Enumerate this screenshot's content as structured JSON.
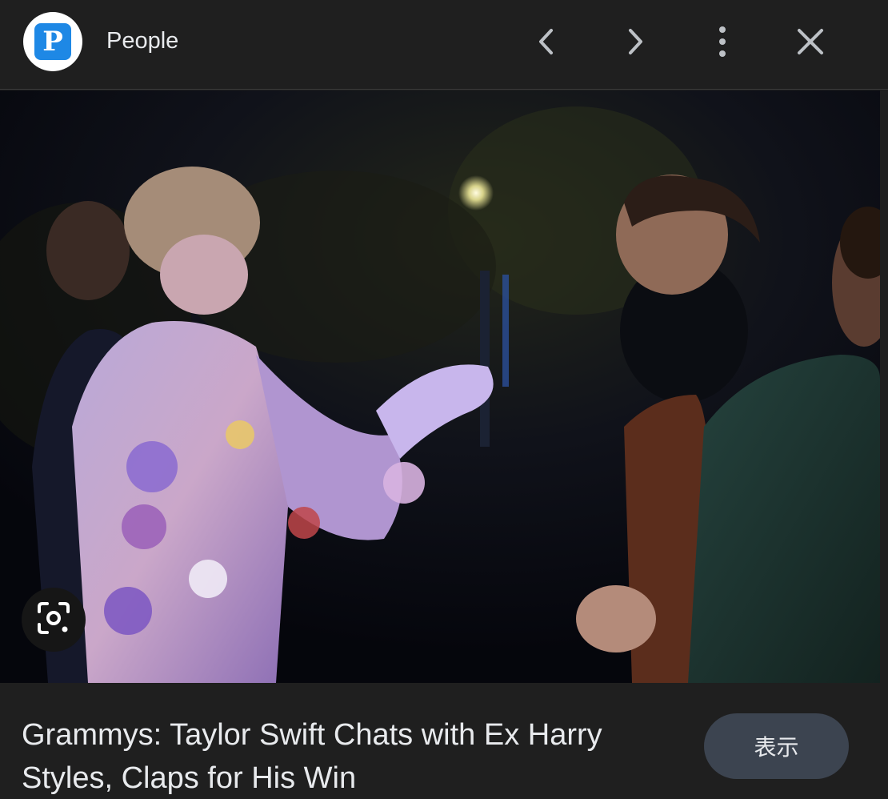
{
  "header": {
    "site_logo_letter": "P",
    "site_name": "People",
    "icons": {
      "prev": "chevron-left-icon",
      "next": "chevron-right-icon",
      "more": "more-vert-icon",
      "close": "close-icon"
    }
  },
  "image": {
    "lens_icon": "google-lens-icon"
  },
  "footer": {
    "headline": "Grammys: Taylor Swift Chats with Ex Harry Styles, Claps for His Win",
    "view_button_label": "表示"
  },
  "colors": {
    "background": "#1f1f1f",
    "text": "#e8eaed",
    "icon": "#bdc1c6",
    "view_button": "#3c4450",
    "logo_blue": "#1e88e5"
  }
}
